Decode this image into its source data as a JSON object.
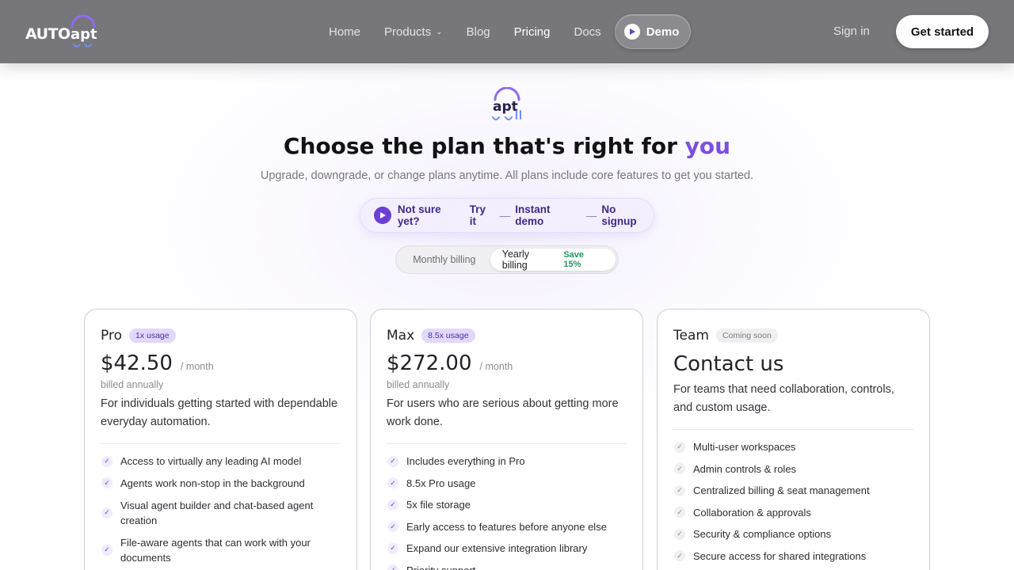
{
  "nav": {
    "logo_text": "AUTO",
    "logo_suffix": "apt",
    "links": [
      {
        "label": "Home"
      },
      {
        "label": "Products"
      },
      {
        "label": "Blog"
      },
      {
        "label": "Pricing"
      },
      {
        "label": "Docs"
      }
    ],
    "demo_label": "Demo",
    "signin_label": "Sign in",
    "cta_label": "Get started"
  },
  "hero": {
    "title_main": "Choose the plan that's right for ",
    "title_accent": "you",
    "subtitle": "Upgrade, downgrade, or change plans anytime. All plans include core features to get you started.",
    "try": {
      "part1": "Not sure yet?",
      "part2": "Try it",
      "dash": "—",
      "part3": "Instant demo",
      "part4": "No signup"
    },
    "billing": {
      "monthly": "Monthly billing",
      "yearly": "Yearly billing",
      "save": "Save 15%"
    }
  },
  "plans": [
    {
      "name": "Pro",
      "badge": "1x usage",
      "price": "$42.50",
      "per": "/ month",
      "billed": "billed annually",
      "desc": "For individuals getting started with dependable everyday automation.",
      "features": [
        "Access to virtually any leading AI model",
        "Agents work non-stop in the background",
        "Visual agent builder and chat-based agent creation",
        "File-aware agents that can work with your documents"
      ]
    },
    {
      "name": "Max",
      "badge": "8.5x usage",
      "price": "$272.00",
      "per": "/ month",
      "billed": "billed annually",
      "desc": "For users who are serious about getting more work done.",
      "features": [
        "Includes everything in Pro",
        "8.5x Pro usage",
        "5x file storage",
        "Early access to features before anyone else",
        "Expand our extensive integration library",
        "Priority support"
      ]
    },
    {
      "name": "Team",
      "badge": "Coming soon",
      "contact": "Contact us",
      "desc": "For teams that need collaboration, controls, and custom usage.",
      "features": [
        "Multi-user workspaces",
        "Admin controls & roles",
        "Centralized billing & seat management",
        "Collaboration & approvals",
        "Security & compliance options",
        "Secure access for shared integrations"
      ]
    }
  ],
  "colors": {
    "accent": "#7b4fe0",
    "nav_bg": "#76767b",
    "save_green": "#1e9a5d"
  },
  "icons": [
    "play-icon",
    "chevron-down-icon",
    "check-icon",
    "autoapt-logo-icon"
  ]
}
